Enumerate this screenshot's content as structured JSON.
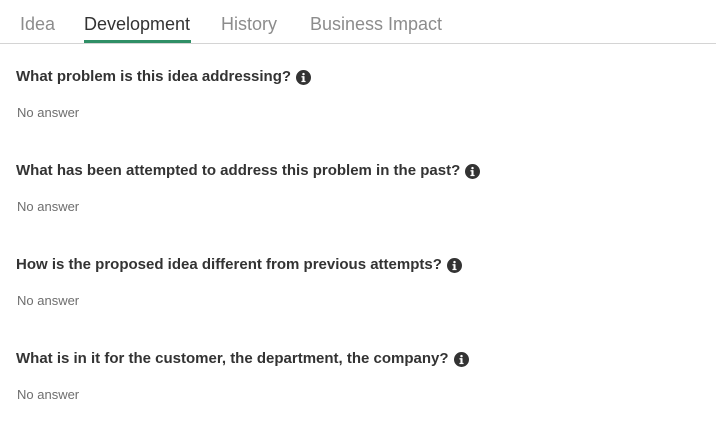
{
  "tabs": [
    {
      "label": "Idea"
    },
    {
      "label": "Development",
      "active": true
    },
    {
      "label": "History"
    },
    {
      "label": "Business Impact"
    }
  ],
  "accent_color": "#2f8f66",
  "info_icon": "info-circle-icon",
  "questions": [
    {
      "question": "What problem is this idea addressing?",
      "answer": "No answer"
    },
    {
      "question": "What has been attempted to address this problem in the past?",
      "answer": "No answer"
    },
    {
      "question": "How is the proposed idea different from previous attempts?",
      "answer": "No answer"
    },
    {
      "question": "What is in it for the customer, the department, the company?",
      "answer": "No answer"
    }
  ]
}
